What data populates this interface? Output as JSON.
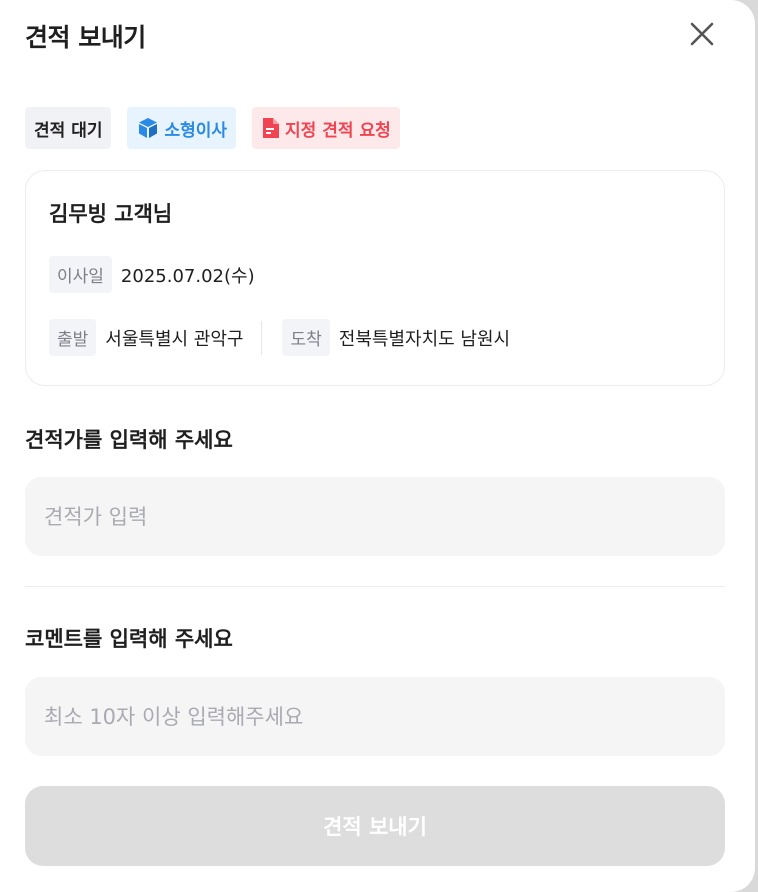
{
  "header": {
    "title": "견적 보내기",
    "close_icon": "close-icon"
  },
  "tags": {
    "status": "견적 대기",
    "move_type": "소형이사",
    "move_type_icon": "box-icon",
    "request": "지정 견적 요청",
    "request_icon": "document-icon"
  },
  "card": {
    "customer": "김무빙 고객님",
    "date_label": "이사일",
    "date_value": "2025.07.02(수)",
    "from_label": "출발",
    "from_value": "서울특별시 관악구",
    "to_label": "도착",
    "to_value": "전북특별자치도 남원시"
  },
  "price": {
    "title": "견적가를 입력해 주세요",
    "placeholder": "견적가 입력",
    "value": ""
  },
  "comment": {
    "title": "코멘트를 입력해 주세요",
    "placeholder": "최소 10자 이상 입력해주세요",
    "value": ""
  },
  "submit": {
    "label": "견적 보내기",
    "enabled": false
  },
  "colors": {
    "type_tag": "#2a8ae6",
    "request_tag": "#f04452",
    "disabled_button": "#dddddd"
  }
}
